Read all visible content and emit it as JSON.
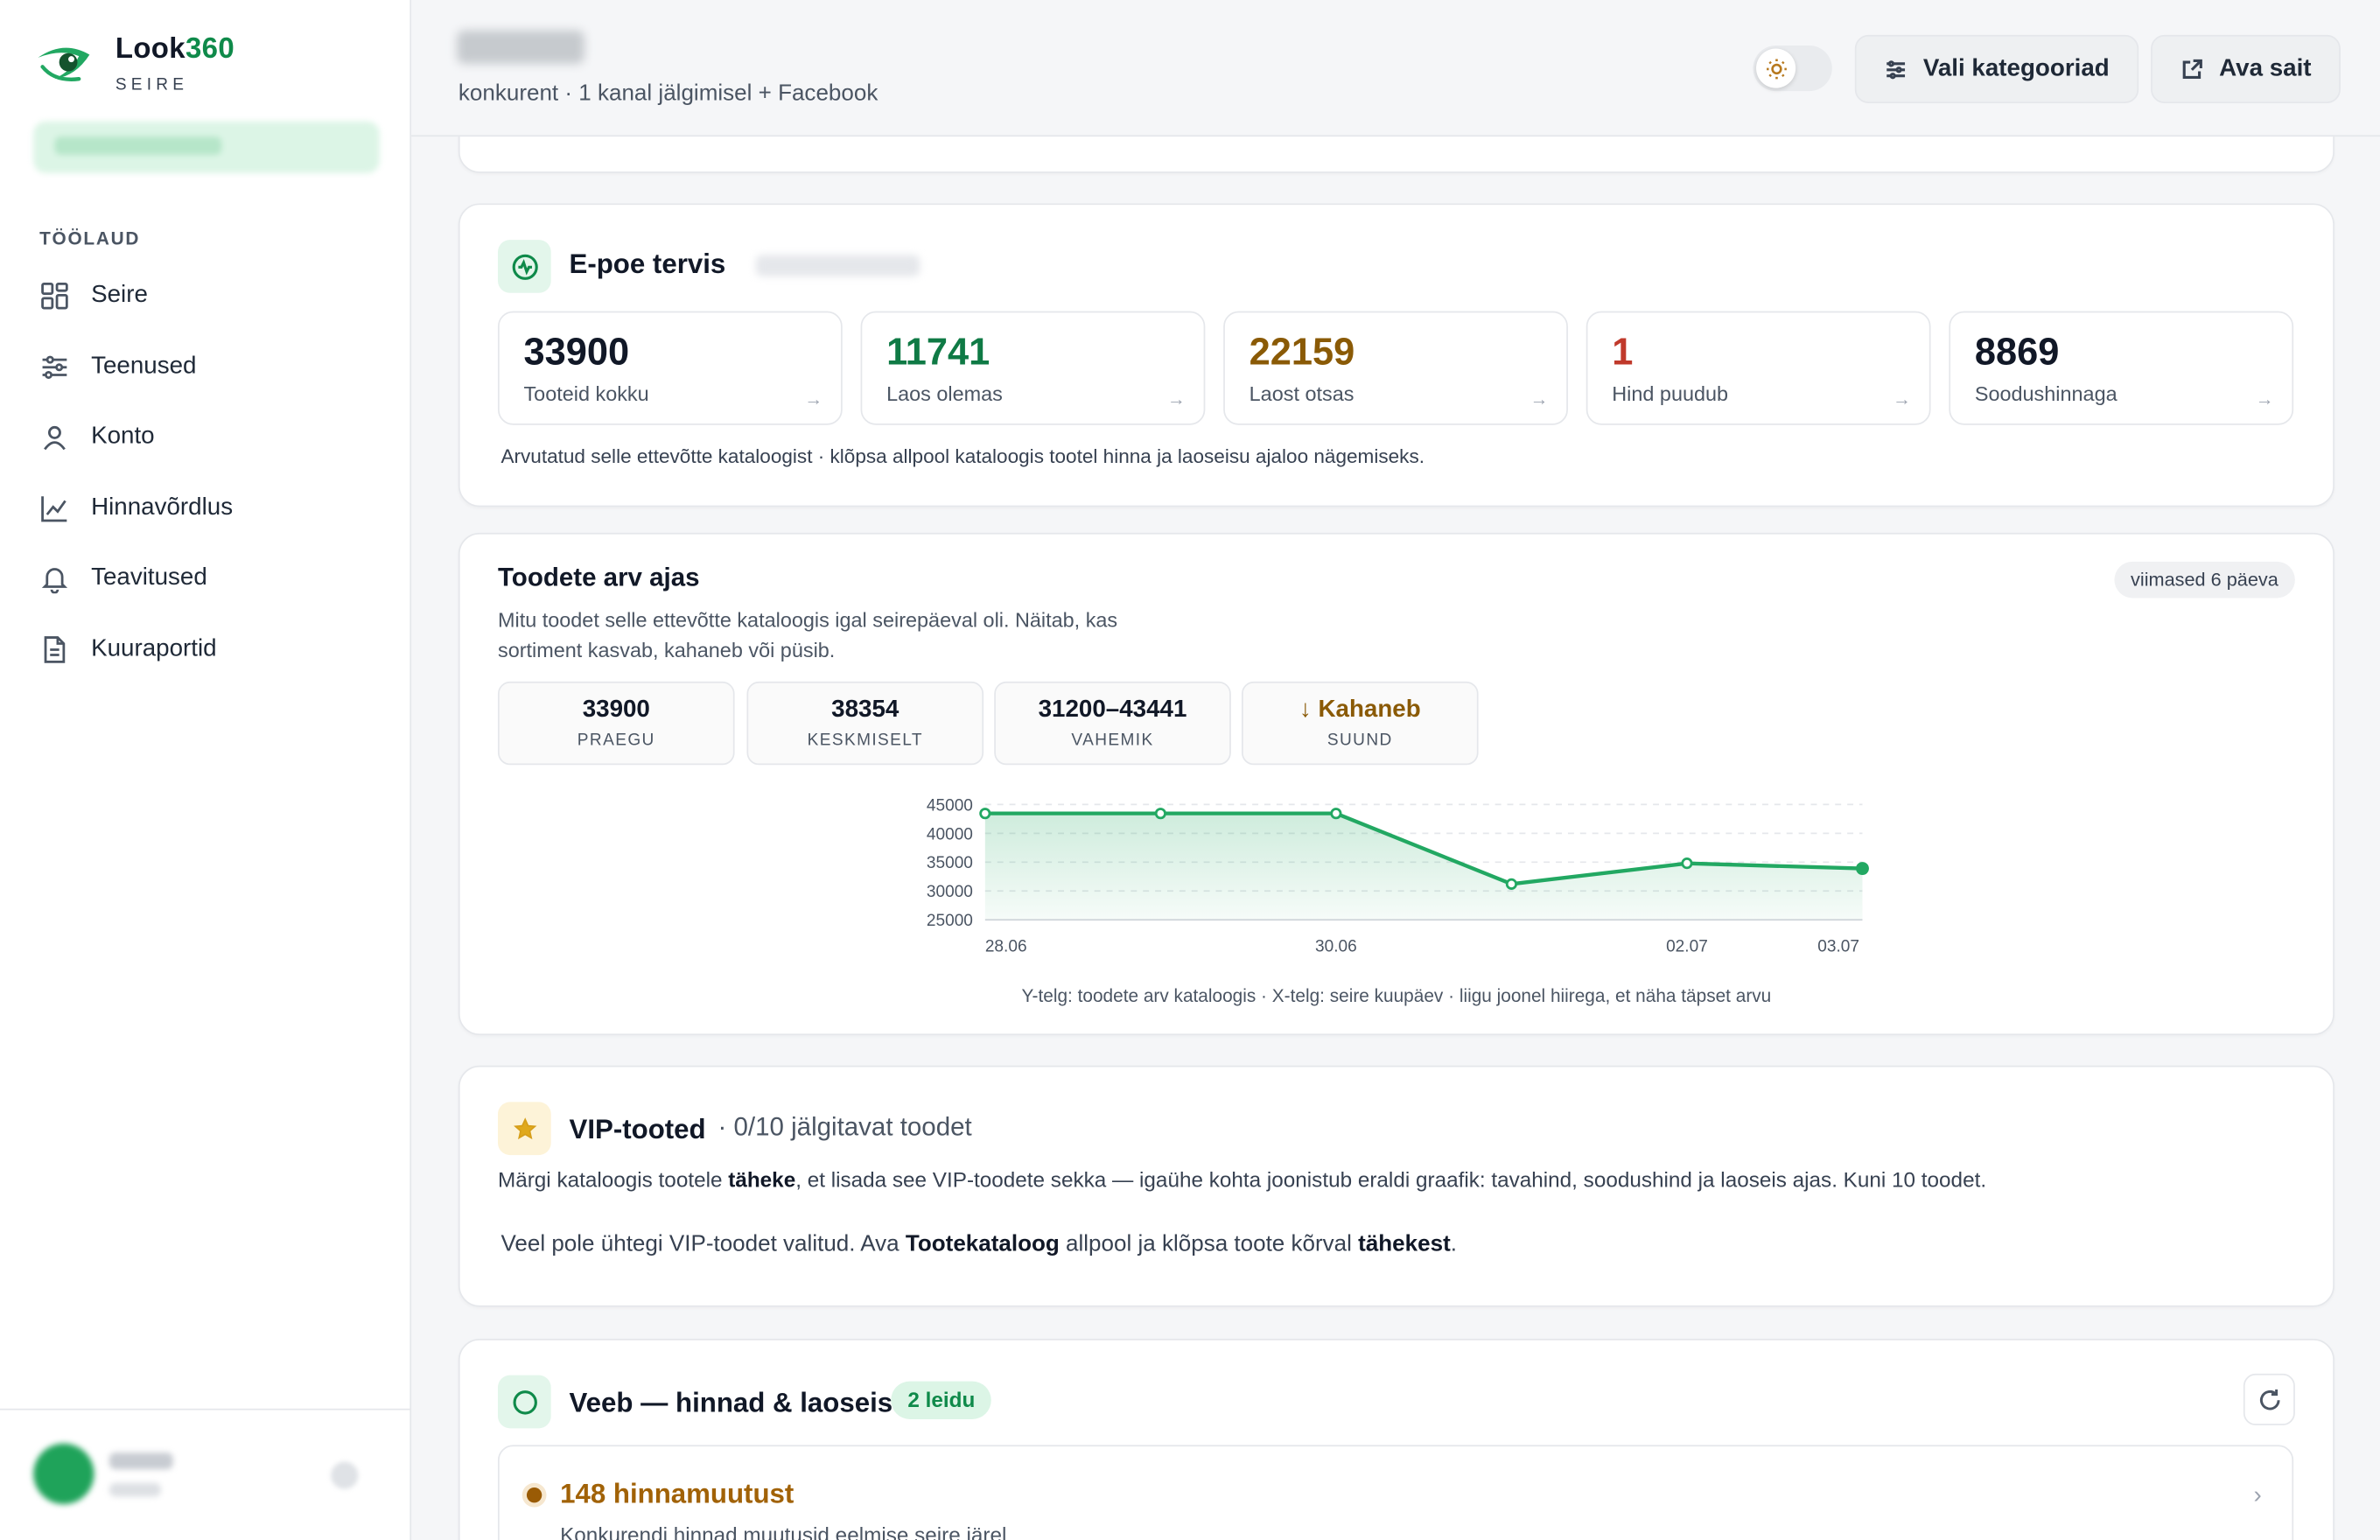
{
  "brand": {
    "name_main": "Look",
    "name_accent": "360",
    "sub": "SEIRE"
  },
  "sidebar": {
    "heading": "TÖÖLAUD",
    "items": [
      {
        "label": "Seire",
        "icon": "grid-icon"
      },
      {
        "label": "Teenused",
        "icon": "sliders-icon"
      },
      {
        "label": "Konto",
        "icon": "user-icon"
      },
      {
        "label": "Hinnavõrdlus",
        "icon": "chart-line-icon"
      },
      {
        "label": "Teavitused",
        "icon": "bell-icon"
      },
      {
        "label": "Kuuraportid",
        "icon": "document-icon"
      }
    ]
  },
  "header": {
    "subtitle": "konkurent · 1 kanal jälgimisel + Facebook",
    "btn_categories": "Vali kategooriad",
    "btn_open_site": "Ava sait"
  },
  "health": {
    "title": "E-poe tervis",
    "stats": [
      {
        "value": "33900",
        "label": "Tooteid kokku",
        "color": "#111827"
      },
      {
        "value": "11741",
        "label": "Laos olemas",
        "color": "#0f7a45"
      },
      {
        "value": "22159",
        "label": "Laost otsas",
        "color": "#8a5a06"
      },
      {
        "value": "1",
        "label": "Hind puudub",
        "color": "#c0392b"
      },
      {
        "value": "8869",
        "label": "Soodushinnaga",
        "color": "#111827"
      }
    ],
    "note": "Arvutatud selle ettevõtte kataloogist · klõpsa allpool kataloogis tootel hinna ja laoseisu ajaloo nägemiseks."
  },
  "products_over_time": {
    "title": "Toodete arv ajas",
    "badge": "viimased 6 päeva",
    "description": "Mitu toodet selle ettevõtte kataloogis igal seirepäeval oli. Näitab, kas sortiment kasvab, kahaneb või püsib.",
    "kpis": [
      {
        "value": "33900",
        "label": "PRAEGU"
      },
      {
        "value": "38354",
        "label": "KESKMISELT"
      },
      {
        "value": "31200–43441",
        "label": "VAHEMIK"
      },
      {
        "value": "↓ Kahaneb",
        "label": "SUUND",
        "color": "#8a5a06"
      }
    ],
    "caption": "Y-telg: toodete arv kataloogis · X-telg: seire kuupäev · liigu joonel hiirega, et näha täpset arvu"
  },
  "chart_data": {
    "type": "area",
    "x": [
      "28.06",
      "29.06",
      "30.06",
      "01.07",
      "02.07",
      "03.07"
    ],
    "x_tick_labels": [
      "28.06",
      "30.06",
      "02.07",
      "03.07"
    ],
    "y_ticks": [
      25000,
      30000,
      35000,
      40000,
      45000
    ],
    "ylim": [
      25000,
      45000
    ],
    "series": [
      {
        "values": [
          43441,
          43441,
          43441,
          31200,
          34800,
          33900
        ]
      }
    ],
    "line_color": "#22a862",
    "grid": true
  },
  "vip": {
    "title": "VIP-tooted",
    "count": "· 0/10 jälgitavat toodet",
    "line_a": "Märgi kataloogis tootele ",
    "line_b": "täheke",
    "line_c": ", et lisada see VIP-toodete sekka — igaühe kohta joonistub eraldi graafik: tavahind, soodushind ja laoseis ajas. Kuni 10 toodet.",
    "empty_a": "Veel pole ühtegi VIP-toodet valitud. Ava ",
    "empty_b": "Tootekataloog",
    "empty_c": " allpool ja klõpsa toote kõrval ",
    "empty_d": "tähekest",
    "empty_e": "."
  },
  "web": {
    "title": "Veeb — hinnad & laoseis",
    "badge": "2 leidu",
    "change_title": "148 hinnamuutust",
    "change_sub": "Konkurendi hinnad muutusid eelmise seire järel"
  }
}
